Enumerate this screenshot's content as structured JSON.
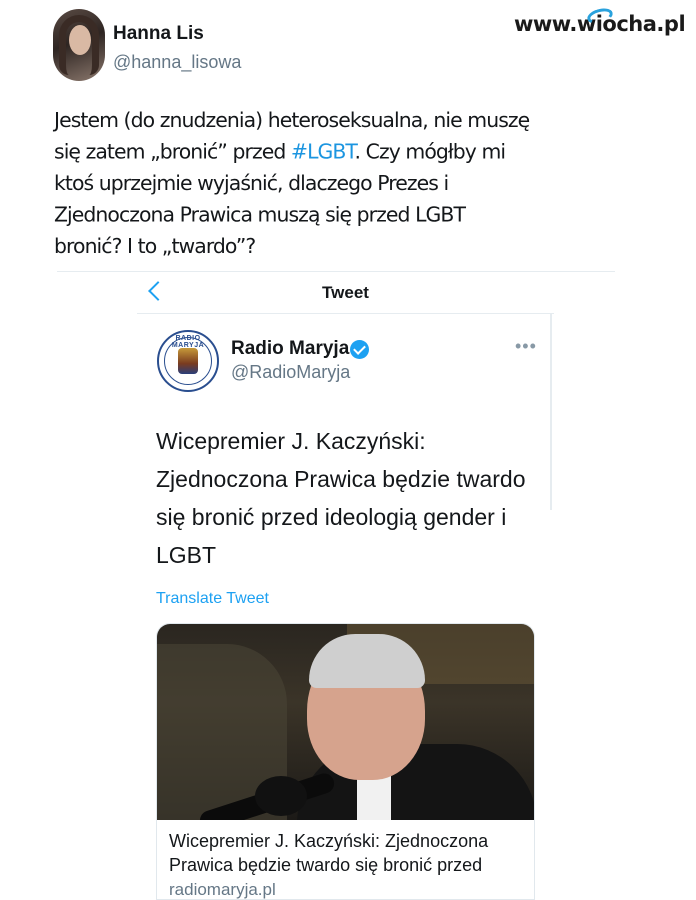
{
  "watermark": {
    "text": "www.wiocha.pl"
  },
  "outer_tweet": {
    "author_name": "Hanna Lis",
    "author_handle": "@hanna_lisowa",
    "text_before": "Jestem (do znudzenia) heteroseksualna, nie muszę się zatem „bronić” przed ",
    "hashtag": "#LGBT",
    "text_after": ". Czy mógłby mi ktoś uprzejmie wyjaśnić, dlaczego Prezes i Zjednoczona Prawica muszą się przed LGBT bronić? I to „twardo”?"
  },
  "quoted_screen": {
    "header_title": "Tweet",
    "avatar_text": "RADIO MARYJA",
    "author_name": "Radio Maryja",
    "author_handle": "@RadioMaryja",
    "more_label": "•••",
    "text": "Wicepremier J. Kaczyński: Zjednoczona Prawica będzie twardo się bronić przed ideologią gender i LGBT",
    "translate_label": "Translate Tweet",
    "card": {
      "title": "Wicepremier J. Kaczyński: Zjednoczona Prawica będzie twardo się bronić przed",
      "domain": "radiomaryja.pl"
    }
  },
  "colors": {
    "link_blue": "#1da1f2",
    "hashtag_blue": "#1b95e0",
    "text": "#14171a",
    "muted": "#657786"
  },
  "icons": [
    "back-chevron-icon",
    "verified-badge-icon",
    "more-options-icon"
  ]
}
